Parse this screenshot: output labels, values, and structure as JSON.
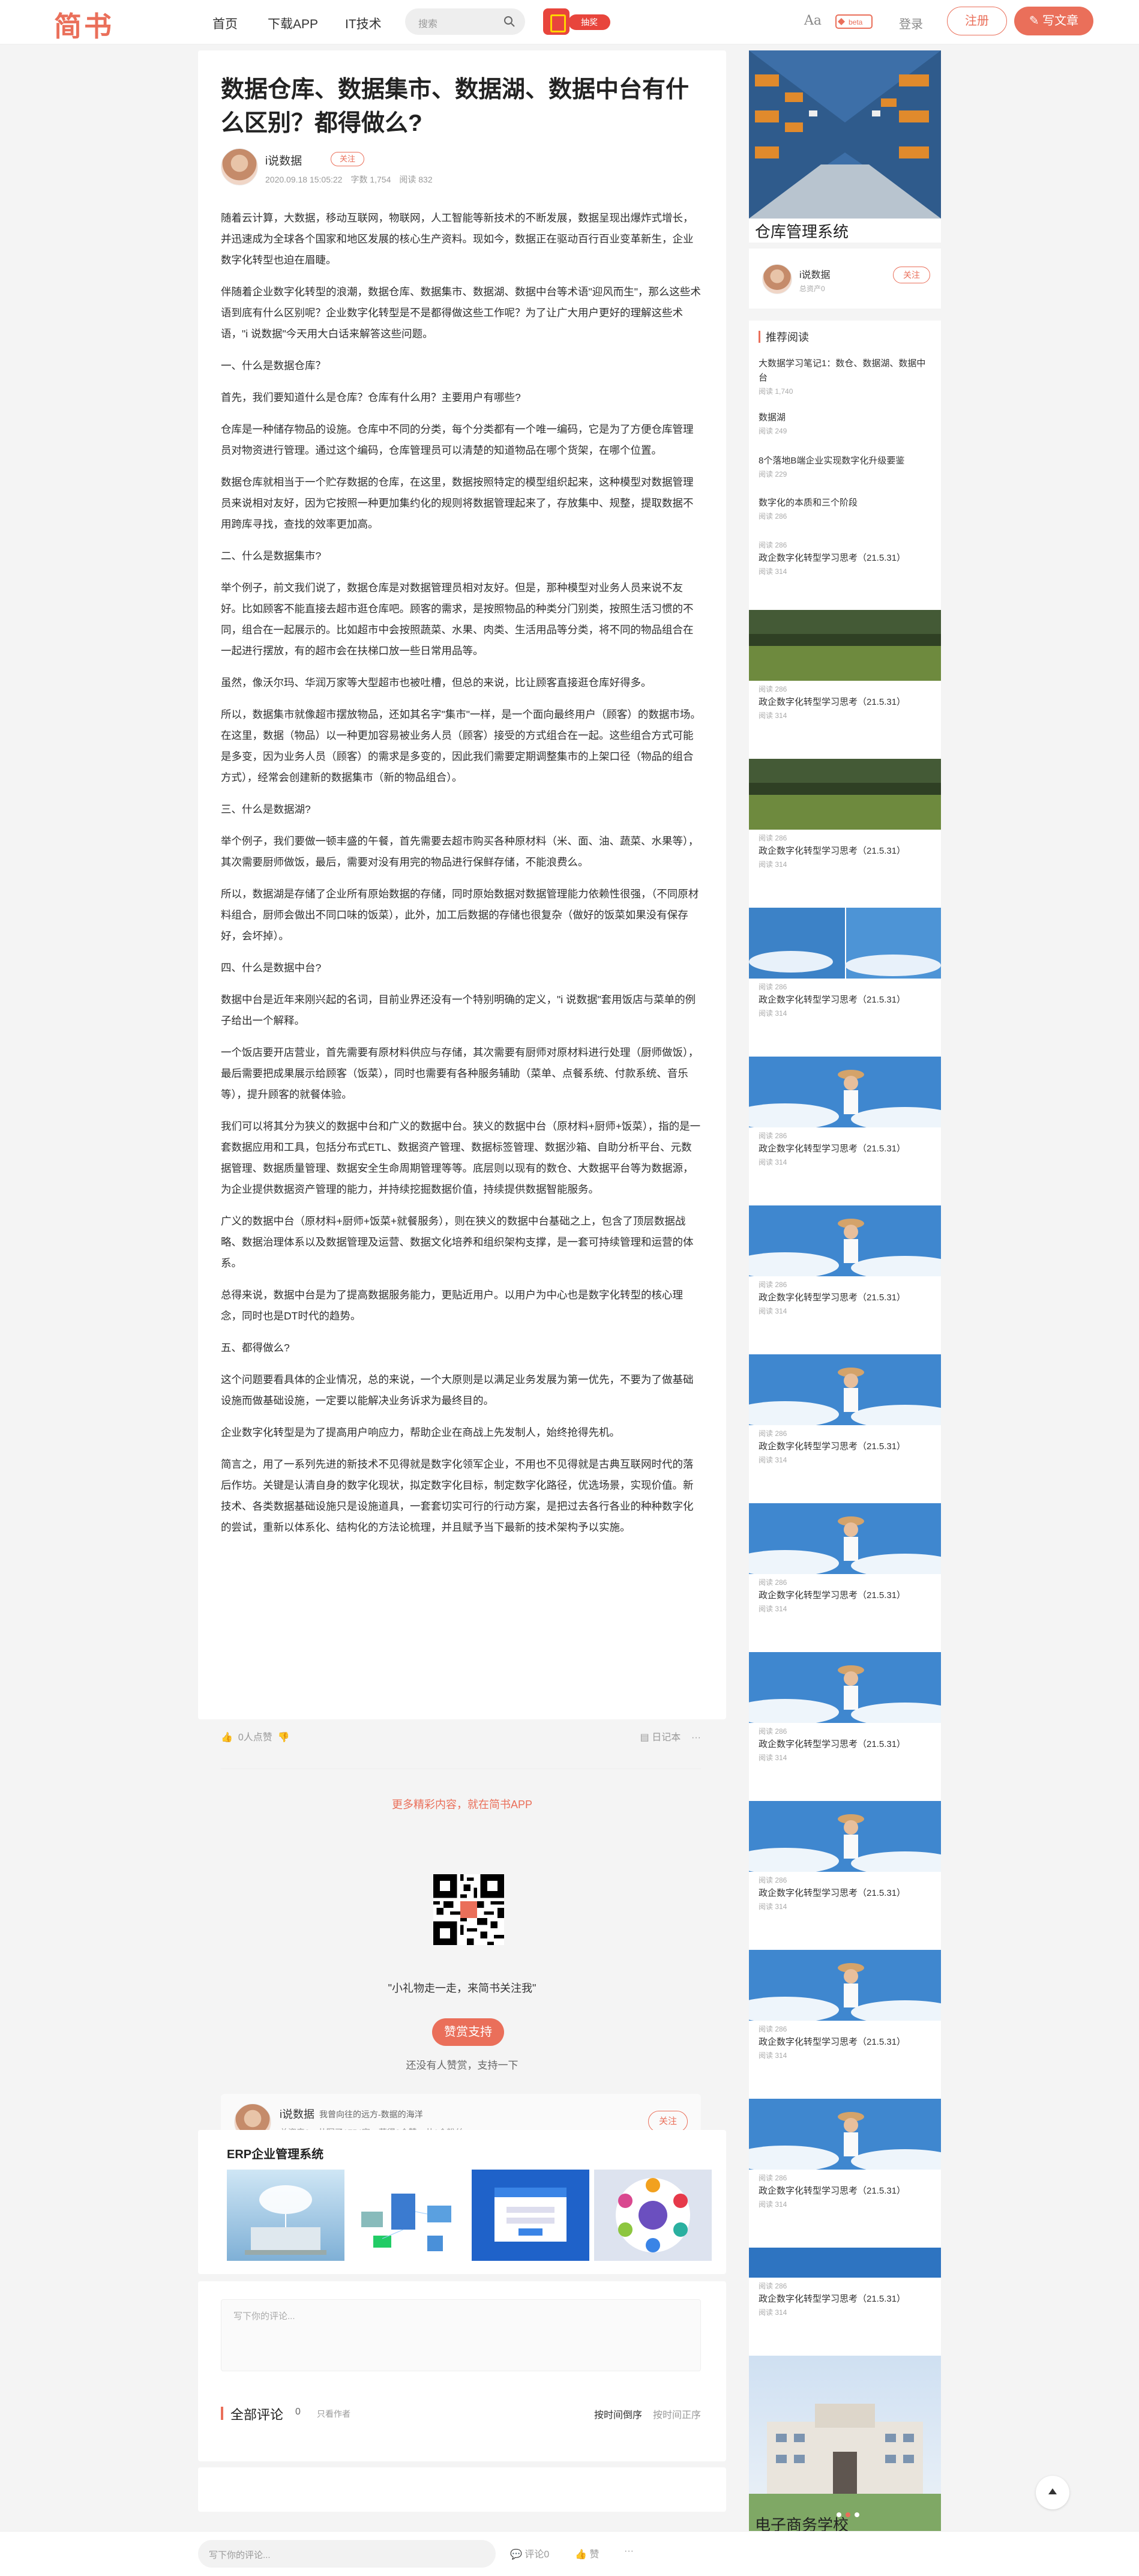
{
  "header": {
    "logo": "简书",
    "nav": [
      "首页",
      "下载APP",
      "IT技术"
    ],
    "search_placeholder": "搜索",
    "promo_tag": "抽奖",
    "font_toggle": "Aa",
    "beta_badge": "beta",
    "login": "登录",
    "register": "注册",
    "write": "写文章",
    "accent_color": "#ea6f5a"
  },
  "article": {
    "title": "数据仓库、数据集市、数据湖、数据中台有什么区别？都得做么?",
    "author": "i说数据",
    "follow": "关注",
    "meta": "2020.09.18 15:05:22　字数 1,754　阅读 832",
    "paragraphs": [
      "随着云计算，大数据，移动互联网，物联网，人工智能等新技术的不断发展，数据呈现出爆炸式增长，并迅速成为全球各个国家和地区发展的核心生产资料。现如今，数据正在驱动百行百业变革新生，企业数字化转型也迫在眉睫。",
      "伴随着企业数字化转型的浪潮，数据仓库、数据集市、数据湖、数据中台等术语\"迎风而生\"，那么这些术语到底有什么区别呢？企业数字化转型是不是都得做这些工作呢？为了让广大用户更好的理解这些术语，\"i 说数据\"今天用大白话来解答这些问题。",
      "一、什么是数据仓库？",
      "首先，我们要知道什么是仓库？仓库有什么用？主要用户有哪些?",
      "仓库是一种储存物品的设施。仓库中不同的分类，每个分类都有一个唯一编码，它是为了方便仓库管理员对物资进行管理。通过这个编码，仓库管理员可以清楚的知道物品在哪个货架，在哪个位置。",
      "数据仓库就相当于一个贮存数据的仓库，在这里，数据按照特定的模型组织起来，这种模型对数据管理员来说相对友好，因为它按照一种更加集约化的规则将数据管理起来了，存放集中、规整，提取数据不用跨库寻找，查找的效率更加高。",
      "二、什么是数据集市?",
      "举个例子，前文我们说了，数据仓库是对数据管理员相对友好。但是，那种模型对业务人员来说不友好。比如顾客不能直接去超市逛仓库吧。顾客的需求，是按照物品的种类分门别类，按照生活习惯的不同，组合在一起展示的。比如超市中会按照蔬菜、水果、肉类、生活用品等分类，将不同的物品组合在一起进行摆放，有的超市会在扶梯口放一些日常用品等。",
      "虽然，像沃尔玛、华润万家等大型超市也被吐槽，但总的来说，比让顾客直接逛仓库好得多。",
      "所以，数据集市就像超市摆放物品，还如其名字\"集市\"一样，是一个面向最终用户（顾客）的数据市场。在这里，数据（物品）以一种更加容易被业务人员（顾客）接受的方式组合在一起。这些组合方式可能是多变，因为业务人员（顾客）的需求是多变的，因此我们需要定期调整集市的上架口径（物品的组合方式），经常会创建新的数据集市（新的物品组合）。",
      "三、什么是数据湖?",
      "举个例子，我们要做一顿丰盛的午餐，首先需要去超市购买各种原材料（米、面、油、蔬菜、水果等），其次需要厨师做饭，最后，需要对没有用完的物品进行保鲜存储，不能浪费么。",
      "所以，数据湖是存储了企业所有原始数据的存储，同时原始数据对数据管理能力依赖性很强，（不同原材料组合，厨师会做出不同口味的饭菜），此外，加工后数据的存储也很复杂（做好的饭菜如果没有保存好，会坏掉）。",
      "四、什么是数据中台?",
      "数据中台是近年来刚兴起的名词，目前业界还没有一个特别明确的定义，\"i 说数据\"套用饭店与菜单的例子给出一个解释。",
      "一个饭店要开店营业，首先需要有原材料供应与存储，其次需要有厨师对原材料进行处理（厨师做饭），最后需要把成果展示给顾客（饭菜），同时也需要有各种服务辅助（菜单、点餐系统、付款系统、音乐等），提升顾客的就餐体验。",
      "我们可以将其分为狭义的数据中台和广义的数据中台。狭义的数据中台（原材料+厨师+饭菜），指的是一套数据应用和工具，包括分布式ETL、数据资产管理、数据标签管理、数据沙箱、自助分析平台、元数据管理、数据质量管理、数据安全生命周期管理等等。底层则以现有的数仓、大数据平台等为数据源，为企业提供数据资产管理的能力，并持续挖掘数据价值，持续提供数据智能服务。",
      "广义的数据中台（原材料+厨师+饭菜+就餐服务），则在狭义的数据中台基础之上，包含了顶层数据战略、数据治理体系以及数据管理及运营、数据文化培养和组织架构支撑，是一套可持续管理和运营的体系。",
      "总得来说，数据中台是为了提高数据服务能力，更贴近用户。以用户为中心也是数字化转型的核心理念，同时也是DT时代的趋势。",
      "五、都得做么?",
      "这个问题要看具体的企业情况，总的来说，一个大原则是以满足业务发展为第一优先，不要为了做基础设施而做基础设施，一定要以能解决业务诉求为最终目的。",
      "企业数字化转型是为了提高用户响应力，帮助企业在商战上先发制人，始终抢得先机。",
      "简言之，用了一系列先进的新技术不见得就是数字化领军企业，不用也不见得就是古典互联网时代的落后作坊。关键是认清自身的数字化现状，拟定数字化目标，制定数字化路径，优选场景，实现价值。新技术、各类数据基础设施只是设施道具，一套套切实可行的行动方案，是把过去各行各业的种种数字化的尝试，重新以体系化、结构化的方法论梳理，并且赋予当下最新的技术架构予以实施。"
    ],
    "like_count": "0人点赞",
    "diary": "日记本",
    "more_app": "更多精彩内容，就在简书APP",
    "gift_text": "\"小礼物走一走，来简书关注我\"",
    "reward_button": "赞赏支持",
    "no_reward": "还没有人赞赏，支持一下",
    "card": {
      "name": "i说数据",
      "desc": "我曾向往的远方-数据的海洋",
      "meta": "总资产0　共写了1754字　获得0个赞　共1个粉丝",
      "follow": "关注"
    }
  },
  "erp": {
    "title": "ERP企业管理系统",
    "images": [
      "cloud-laptop",
      "network-devices",
      "erp-login",
      "app-circle"
    ]
  },
  "comments": {
    "placeholder": "写下你的评论...",
    "title": "全部评论",
    "count": "0",
    "only_author": "只看作者",
    "sort_time": "按时间倒序",
    "sort_time_asc": "按时间正序"
  },
  "bottom": {
    "placeholder": "写下你的评论...",
    "comment": "评论0",
    "like": "赞",
    "more": "···"
  },
  "sidebar": {
    "top_caption": "仓库管理系统",
    "author": "i说数据",
    "author_meta": "总资产0",
    "follow": "关注",
    "recommend_title": "推荐阅读",
    "items": [
      {
        "title": "大数据学习笔记1：数仓、数据湖、数据中台",
        "reads": "阅读 1,740"
      },
      {
        "title": "数据湖",
        "reads": "阅读 249"
      },
      {
        "title": "8个落地B端企业实现数字化升级要鉴",
        "reads": "阅读 229"
      },
      {
        "title": "数字化的本质和三个阶段",
        "reads": "阅读 286"
      },
      {
        "title": "政企数字化转型学习思考（21.5.31）",
        "reads": "阅读 286",
        "reads2": "阅读 314"
      }
    ],
    "repeat_title": "政企数字化转型学习思考（21.5.31）",
    "repeat_reads": "阅读 286",
    "repeat_reads2": "阅读 314",
    "last_caption": "电子商务学校"
  }
}
